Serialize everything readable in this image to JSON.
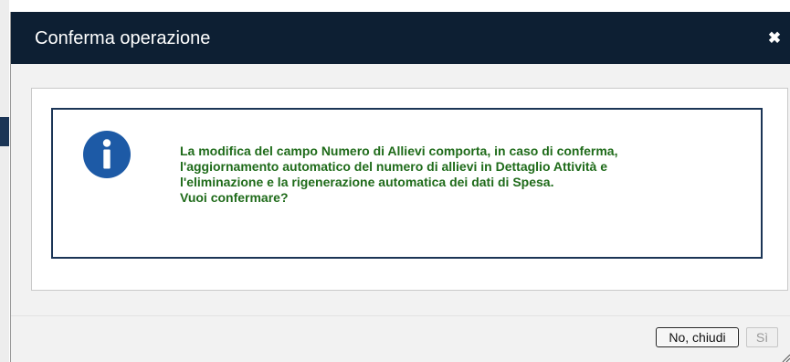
{
  "dialog": {
    "title": "Conferma operazione",
    "close_icon": "close-icon",
    "info_icon": "info-icon",
    "message_lines": [
      "La modifica del campo Numero di Allievi comporta, in caso di conferma,",
      "l'aggiornamento automatico del numero di allievi in Dettaglio Attività e",
      "l'eliminazione e la rigenerazione automatica dei dati di Spesa.",
      "Vuoi confermare?"
    ],
    "buttons": {
      "no_label": "No, chiudi",
      "yes_label": "Sì"
    }
  },
  "colors": {
    "titlebar": "#0d1f33",
    "message_text": "#1f6b1a",
    "info_icon": "#1d5aa6",
    "message_border": "#1b3556"
  }
}
